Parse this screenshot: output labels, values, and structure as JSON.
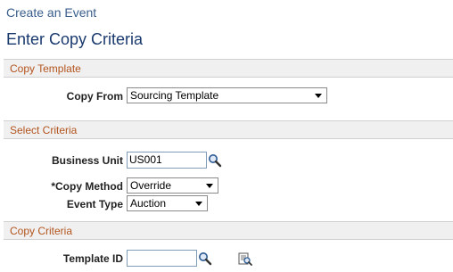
{
  "breadcrumb": "Create an Event",
  "page_title": "Enter Copy Criteria",
  "sections": {
    "copy_template": "Copy Template",
    "select_criteria": "Select Criteria",
    "copy_criteria": "Copy Criteria"
  },
  "copy_template": {
    "copy_from_label": "Copy From",
    "copy_from_value": "Sourcing Template"
  },
  "select_criteria": {
    "business_unit_label": "Business Unit",
    "business_unit_value": "US001",
    "copy_method_label": "*Copy Method",
    "copy_method_value": "Override",
    "event_type_label": "Event Type",
    "event_type_value": "Auction"
  },
  "copy_criteria": {
    "template_id_label": "Template ID",
    "template_id_value": ""
  },
  "icons": {
    "business_unit_lookup": "magnifier-icon",
    "template_id_lookup": "magnifier-icon",
    "template_id_detail": "detail-view-icon"
  },
  "colors": {
    "breadcrumb": "#3a5e8c",
    "page_title": "#1a3a6e",
    "section_title": "#b3541e",
    "section_bg": "#f0f0f0"
  }
}
